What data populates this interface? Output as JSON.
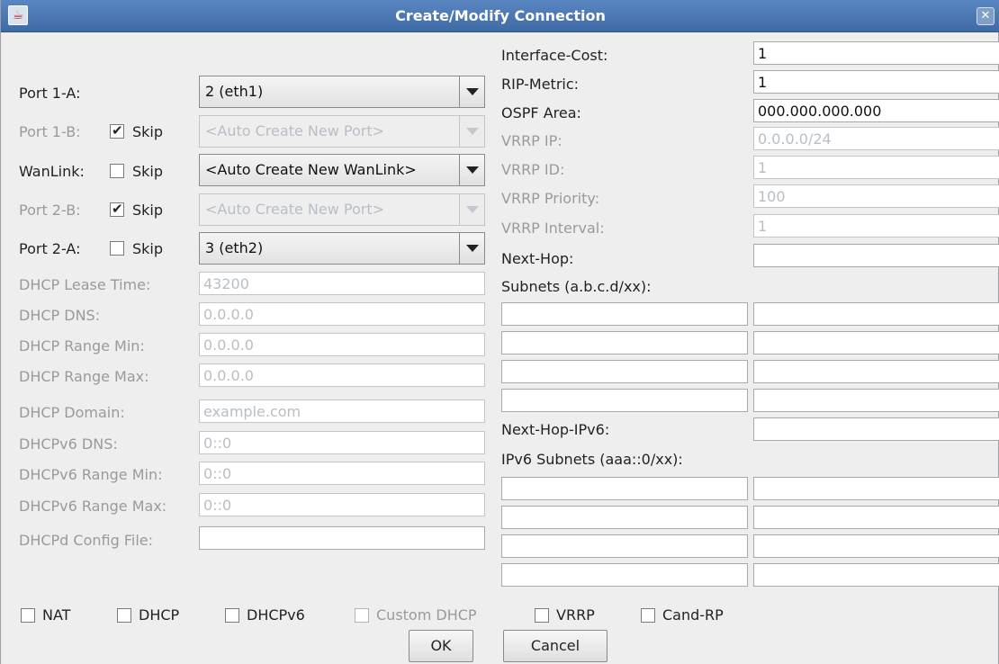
{
  "window": {
    "title": "Create/Modify Connection"
  },
  "left": {
    "port_1a": {
      "label": "Port 1-A:",
      "value": "2 (eth1)"
    },
    "port_1b": {
      "label": "Port 1-B:",
      "skip_label": "Skip",
      "skip_checked": true,
      "value": "<Auto Create New Port>"
    },
    "wanlink": {
      "label": "WanLink:",
      "skip_label": "Skip",
      "skip_checked": false,
      "value": "<Auto Create New WanLink>"
    },
    "port_2b": {
      "label": "Port 2-B:",
      "skip_label": "Skip",
      "skip_checked": true,
      "value": "<Auto Create New Port>"
    },
    "port_2a": {
      "label": "Port 2-A:",
      "skip_label": "Skip",
      "skip_checked": false,
      "value": "3 (eth2)"
    },
    "dhcp": {
      "lease_time": {
        "label": "DHCP Lease Time:",
        "value": "43200"
      },
      "dns": {
        "label": "DHCP DNS:",
        "value": "0.0.0.0"
      },
      "range_min": {
        "label": "DHCP Range Min:",
        "value": "0.0.0.0"
      },
      "range_max": {
        "label": "DHCP Range Max:",
        "value": "0.0.0.0"
      },
      "domain": {
        "label": "DHCP Domain:",
        "value": "example.com"
      },
      "v6_dns": {
        "label": "DHCPv6 DNS:",
        "value": "0::0"
      },
      "v6_range_min": {
        "label": "DHCPv6 Range Min:",
        "value": "0::0"
      },
      "v6_range_max": {
        "label": "DHCPv6 Range Max:",
        "value": "0::0"
      },
      "config_file": {
        "label": "DHCPd Config File:",
        "value": ""
      }
    }
  },
  "right": {
    "interface_cost": {
      "label": "Interface-Cost:",
      "value": "1"
    },
    "rip_metric": {
      "label": "RIP-Metric:",
      "value": "1"
    },
    "ospf_area": {
      "label": "OSPF Area:",
      "value": "000.000.000.000"
    },
    "vrrp_ip": {
      "label": "VRRP IP:",
      "value": "0.0.0.0/24"
    },
    "vrrp_id": {
      "label": "VRRP ID:",
      "value": "1"
    },
    "vrrp_priority": {
      "label": "VRRP Priority:",
      "value": "100"
    },
    "vrrp_interval": {
      "label": "VRRP Interval:",
      "value": "1"
    },
    "next_hop": {
      "label": "Next-Hop:",
      "value": ""
    },
    "subnets_label": "Subnets (a.b.c.d/xx):",
    "next_hop_ipv6": {
      "label": "Next-Hop-IPv6:",
      "value": ""
    },
    "ipv6_subnets_label": "IPv6 Subnets (aaa::0/xx):"
  },
  "options": {
    "nat": {
      "label": "NAT",
      "checked": false
    },
    "dhcp": {
      "label": "DHCP",
      "checked": false
    },
    "dhcpv6": {
      "label": "DHCPv6",
      "checked": false
    },
    "custom_dhcp": {
      "label": "Custom DHCP",
      "checked": false
    },
    "vrrp": {
      "label": "VRRP",
      "checked": false
    },
    "cand_rp": {
      "label": "Cand-RP",
      "checked": false
    }
  },
  "buttons": {
    "ok": "OK",
    "cancel": "Cancel"
  }
}
